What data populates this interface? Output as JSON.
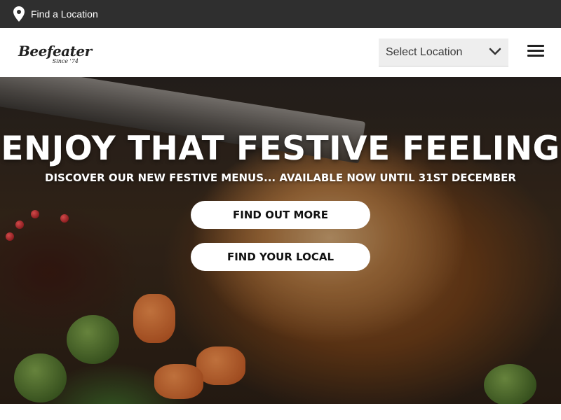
{
  "topbar": {
    "find_location_label": "Find a Location",
    "icon": "map-pin-icon"
  },
  "header": {
    "logo": {
      "name": "Beefeater",
      "tagline": "Since '74"
    },
    "location_select": {
      "selected": "Select Location"
    },
    "menu_icon": "hamburger-icon"
  },
  "hero": {
    "title": "ENJOY THAT FESTIVE FEELING",
    "subtitle": "DISCOVER OUR NEW FESTIVE MENUS... AVAILABLE NOW UNTIL 31ST DECEMBER",
    "buttons": {
      "find_out_more": "FIND OUT MORE",
      "find_your_local": "FIND YOUR LOCAL"
    }
  },
  "colors": {
    "topbar_bg": "#2f2f2f",
    "button_bg": "#ffffff",
    "text_light": "#ffffff"
  }
}
